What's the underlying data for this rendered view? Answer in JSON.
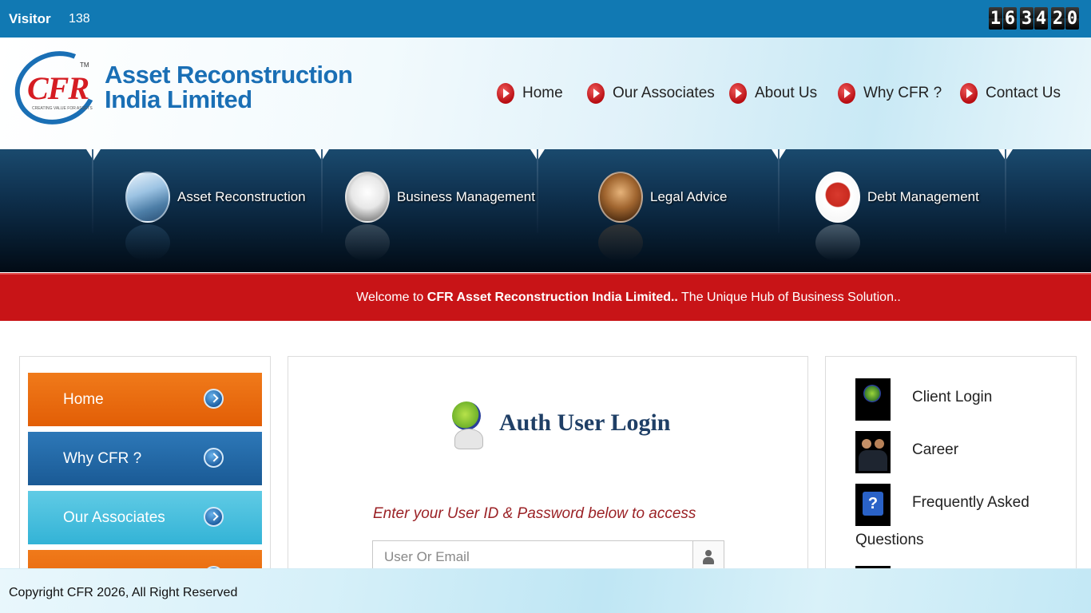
{
  "topbar": {
    "visitor_label": "Visitor",
    "visitor_count": "138",
    "clock_digits": [
      "1",
      "6",
      "3",
      "4",
      "2",
      "0"
    ]
  },
  "brand": {
    "logo_text": "CFR",
    "logo_tm": "TM",
    "logo_tagline": "CREATING VALUE FOR ASSETS",
    "name_line1": "Asset Reconstruction",
    "name_line2": "India Limited"
  },
  "nav": {
    "items": [
      {
        "label": "Home"
      },
      {
        "label": "Our Associates"
      },
      {
        "label": "About Us"
      },
      {
        "label": "Why CFR ?"
      },
      {
        "label": "Contact Us"
      }
    ]
  },
  "services": {
    "items": [
      {
        "label": "Asset Reconstruction",
        "icon": "building-icon"
      },
      {
        "label": "Business Management",
        "icon": "businessman-icon"
      },
      {
        "label": "Legal Advice",
        "icon": "gavel-icon"
      },
      {
        "label": "Debt Management",
        "icon": "debt-icon"
      }
    ]
  },
  "welcome": {
    "prefix": "Welcome to ",
    "company": "CFR Asset Reconstruction India Limited..",
    "suffix": " The Unique Hub of Business Solution.."
  },
  "left_menu": {
    "items": [
      {
        "label": "Home"
      },
      {
        "label": "Why CFR ?"
      },
      {
        "label": "Our Associates"
      }
    ]
  },
  "login": {
    "title": "Auth User Login",
    "hint": "Enter your User ID & Password below to access",
    "user_placeholder": "User Or Email"
  },
  "quick_links": {
    "client_login": "Client Login",
    "career": "Career",
    "faq_line1": "Frequently Asked",
    "faq_line2": "Questions"
  },
  "footer": {
    "copyright": "Copyright CFR 2026, All Right Reserved"
  },
  "colors": {
    "topbar": "#1179b3",
    "brand_blue": "#1a6fb5",
    "welcome_red": "#c81417",
    "menu_orange": "#e8690e",
    "menu_blue": "#1f64a3",
    "menu_cyan": "#45bddd"
  }
}
